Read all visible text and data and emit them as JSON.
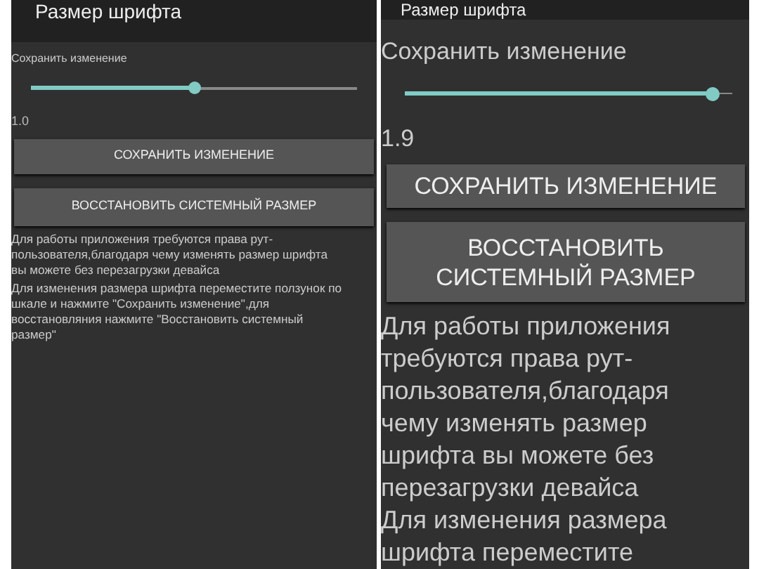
{
  "screens": [
    {
      "title": "Размер шрифта",
      "slider_label": "Сохранить изменение",
      "slider": {
        "level": 0.5
      },
      "value": "1.0",
      "buttons": [
        "СОХРАНИТЬ ИЗМЕНЕНИЕ",
        "ВОССТАНОВИТЬ СИСТЕМНЫЙ РАЗМЕР"
      ],
      "paragraphs": [
        "Для работы приложения требуются права рут-пользователя,благодаря чему изменять размер шрифта вы можете без перезагрузки девайса",
        "Для изменения размера шрифта переместите ползунок по шкале и нажмите \"Сохранить изменение\",для восстановляния нажмите \"Восстановить системный размер\""
      ]
    },
    {
      "title": "Размер шрифта",
      "slider_label": "Сохранить изменение",
      "slider": {
        "level": 0.94
      },
      "value": "1.9",
      "buttons": [
        "СОХРАНИТЬ ИЗМЕНЕНИЕ",
        "ВОССТАНОВИТЬ СИСТЕМНЫЙ РАЗМЕР"
      ],
      "paragraphs": [
        "Для работы приложения требуются права рут-пользователя,благодаря чему изменять размер шрифта вы можете без перезагрузки девайса",
        "Для изменения размера шрифта переместите"
      ]
    }
  ]
}
